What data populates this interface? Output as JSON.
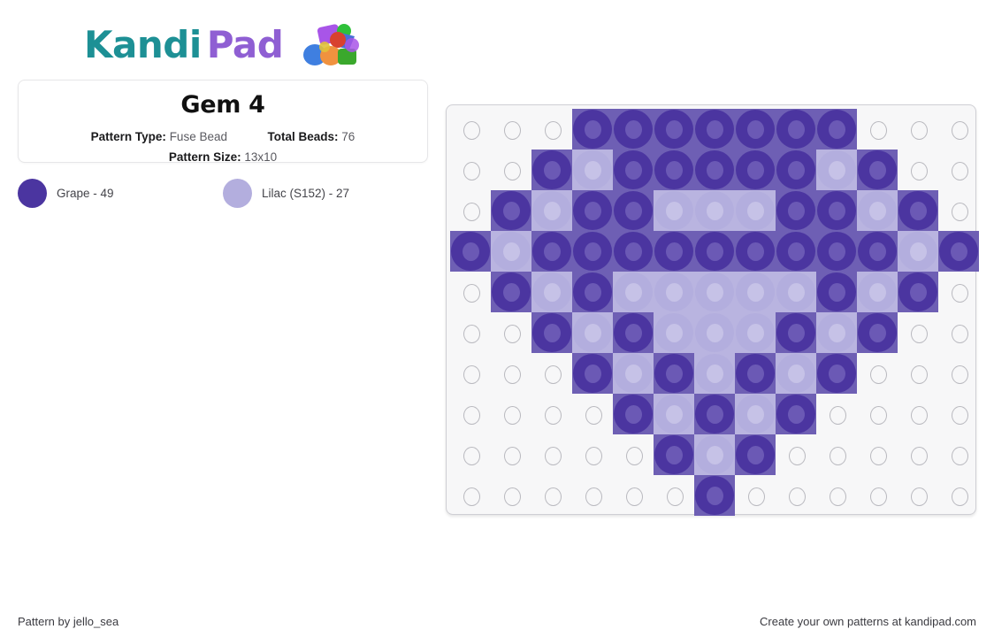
{
  "brand": {
    "name_part1": "Kandi",
    "name_part2": "Pad",
    "teal": "#1d9095",
    "purple": "#8f5fd3"
  },
  "card": {
    "title": "Gem 4",
    "pattern_type_label": "Pattern Type:",
    "pattern_type_value": "Fuse Bead",
    "total_beads_label": "Total Beads:",
    "total_beads_value": "76",
    "pattern_size_label": "Pattern Size:",
    "pattern_size_value": "13x10"
  },
  "legend": {
    "items": [
      {
        "name": "Grape",
        "count": 49,
        "label": "Grape - 49",
        "color": "#4b35a0",
        "hole": "#6b59b5"
      },
      {
        "name": "Lilac (S152)",
        "count": 27,
        "label": "Lilac (S152) - 27",
        "color": "#b3aede",
        "hole": "#c6c2e7"
      }
    ]
  },
  "grid": {
    "cols": 13,
    "rows": 10,
    "empty_color": "#f7f7f8",
    "palette": {
      "G": {
        "ring": "#4b35a0",
        "hole": "#6b59b5",
        "bg": "#6e5fb4"
      },
      "L": {
        "ring": "#b3aede",
        "hole": "#c6c2e7",
        "bg": "#b9b4e0"
      }
    },
    "cells": [
      [
        "",
        "",
        "",
        "G",
        "G",
        "G",
        "G",
        "G",
        "G",
        "G",
        "",
        "",
        ""
      ],
      [
        "",
        "",
        "G",
        "L",
        "G",
        "G",
        "G",
        "G",
        "G",
        "L",
        "G",
        "",
        ""
      ],
      [
        "",
        "G",
        "L",
        "G",
        "G",
        "L",
        "L",
        "L",
        "G",
        "G",
        "L",
        "G",
        ""
      ],
      [
        "G",
        "L",
        "G",
        "G",
        "G",
        "G",
        "G",
        "G",
        "G",
        "G",
        "G",
        "L",
        "G"
      ],
      [
        "",
        "G",
        "L",
        "G",
        "L",
        "L",
        "L",
        "L",
        "L",
        "G",
        "L",
        "G",
        ""
      ],
      [
        "",
        "",
        "G",
        "L",
        "G",
        "L",
        "L",
        "L",
        "G",
        "L",
        "G",
        "",
        ""
      ],
      [
        "",
        "",
        "",
        "G",
        "L",
        "G",
        "L",
        "G",
        "L",
        "G",
        "",
        "",
        ""
      ],
      [
        "",
        "",
        "",
        "",
        "G",
        "L",
        "G",
        "L",
        "G",
        "",
        "",
        "",
        ""
      ],
      [
        "",
        "",
        "",
        "",
        "",
        "G",
        "L",
        "G",
        "",
        "",
        "",
        "",
        ""
      ],
      [
        "",
        "",
        "",
        "",
        "",
        "",
        "G",
        "",
        "",
        "",
        "",
        "",
        ""
      ]
    ]
  },
  "footer": {
    "attribution": "Pattern by jello_sea",
    "promo": "Create your own patterns at kandipad.com"
  }
}
